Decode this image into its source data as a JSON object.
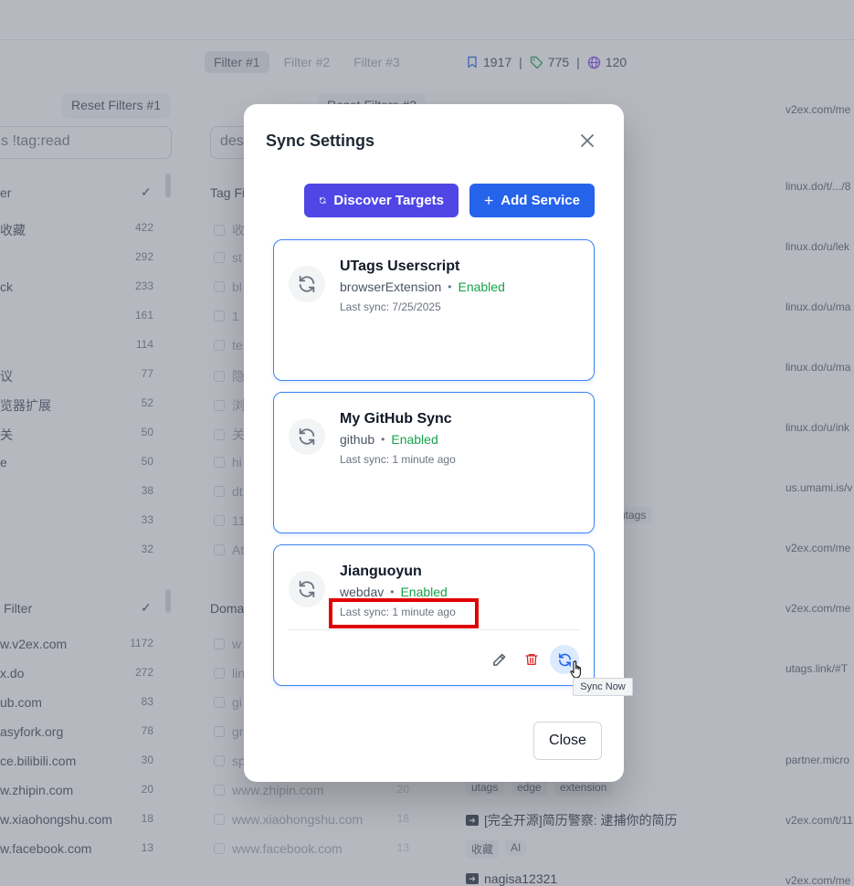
{
  "background": {
    "filter_tabs": [
      "Filter #1",
      "Filter #2",
      "Filter #3"
    ],
    "counters": {
      "bookmarks": "1917",
      "tags": "775",
      "domains": "120"
    },
    "reset_filters_1": "Reset Filters #1",
    "reset_filters_2": "Reset Filters #2",
    "search_1": "s !tag:read",
    "search_2": "des",
    "tag_filter_header": "er",
    "tag_filter_2_header": "Tag Fi",
    "tag_rows": [
      {
        "label": "收藏",
        "count": "422"
      },
      {
        "label": "",
        "count": "292"
      },
      {
        "label": "ck",
        "count": "233"
      },
      {
        "label": "",
        "count": "161"
      },
      {
        "label": "",
        "count": "114"
      },
      {
        "label": "议",
        "count": "77"
      },
      {
        "label": "览器扩展",
        "count": "52"
      },
      {
        "label": "关",
        "count": "50"
      },
      {
        "label": "e",
        "count": "50"
      },
      {
        "label": "",
        "count": "38"
      },
      {
        "label": "",
        "count": "33"
      },
      {
        "label": "",
        "count": "32"
      }
    ],
    "tag_rows_2": [
      "收",
      "st",
      "bl",
      "1",
      "te",
      "隐",
      "浏",
      "关",
      "hi",
      "dt",
      "11",
      "At"
    ],
    "domain_filter_header": "Filter",
    "domain_filter_2_header": "Doma",
    "domain_rows": [
      {
        "label": "w.v2ex.com",
        "count": "1172"
      },
      {
        "label": "x.do",
        "count": "272"
      },
      {
        "label": "ub.com",
        "count": "83"
      },
      {
        "label": "asyfork.org",
        "count": "78"
      },
      {
        "label": "ce.bilibili.com",
        "count": "30"
      },
      {
        "label": "w.zhipin.com",
        "count": "20"
      },
      {
        "label": "w.xiaohongshu.com",
        "count": "18"
      },
      {
        "label": "w.facebook.com",
        "count": "13"
      }
    ],
    "domain_rows_2": [
      {
        "label": "w",
        "count": ""
      },
      {
        "label": "lin",
        "count": ""
      },
      {
        "label": "gi",
        "count": ""
      },
      {
        "label": "gr",
        "count": ""
      },
      {
        "label": "sp",
        "count": ""
      },
      {
        "label": "www.zhipin.com",
        "count": "20"
      },
      {
        "label": "www.xiaohongshu.com",
        "count": "18"
      },
      {
        "label": "www.facebook.com",
        "count": "13"
      }
    ],
    "urls": [
      "v2ex.com/me",
      "linux.do/t/.../8",
      "linux.do/u/lek",
      "linux.do/u/ma",
      "linux.do/u/ma",
      "linux.do/u/ink",
      "us.umami.is/v",
      "v2ex.com/me",
      "v2ex.com/me",
      "utags.link/#T",
      "partner.micro",
      "v2ex.com/t/11",
      "v2ex.com/me"
    ],
    "chips": {
      "utags_1": "utags",
      "utags_2": "utags",
      "edge": "edge",
      "extension": "extension",
      "shoucang": "收藏",
      "ai": "AI"
    },
    "bookmark_1": "[完全开源]简历警察: 逮捕你的简历",
    "bookmark_2": "nagisa12321"
  },
  "modal": {
    "title": "Sync Settings",
    "discover_label": "Discover Targets",
    "add_label": "Add Service",
    "close_label": "Close",
    "services": [
      {
        "name": "UTags Userscript",
        "type": "browserExtension",
        "status": "Enabled",
        "last_sync": "Last sync: 7/25/2025"
      },
      {
        "name": "My GitHub Sync",
        "type": "github",
        "status": "Enabled",
        "last_sync": "Last sync: 1 minute ago"
      },
      {
        "name": "Jianguoyun",
        "type": "webdav",
        "status": "Enabled",
        "last_sync": "Last sync: 1 minute ago"
      }
    ],
    "separator": "•"
  },
  "tooltip": {
    "text": "Sync Now"
  },
  "colors": {
    "accent_indigo": "#4f46e5",
    "accent_blue": "#2563eb",
    "enabled_green": "#16a34a",
    "delete_red": "#dc2626",
    "highlight_red": "#e10000"
  }
}
